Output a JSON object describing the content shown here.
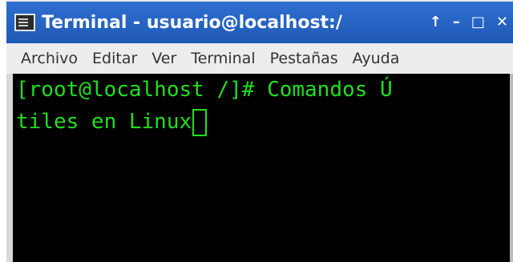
{
  "window": {
    "title": "Terminal - usuario@localhost:/",
    "controls": {
      "up": "↑",
      "minimize": "–",
      "maximize": "□",
      "close": "✕"
    }
  },
  "menubar": {
    "items": [
      "Archivo",
      "Editar",
      "Ver",
      "Terminal",
      "Pestañas",
      "Ayuda"
    ]
  },
  "terminal": {
    "line1": "[root@localhost /]# Comandos Ú",
    "line2": "tiles en Linux",
    "text_color": "#1fe01f",
    "background": "#000000"
  }
}
